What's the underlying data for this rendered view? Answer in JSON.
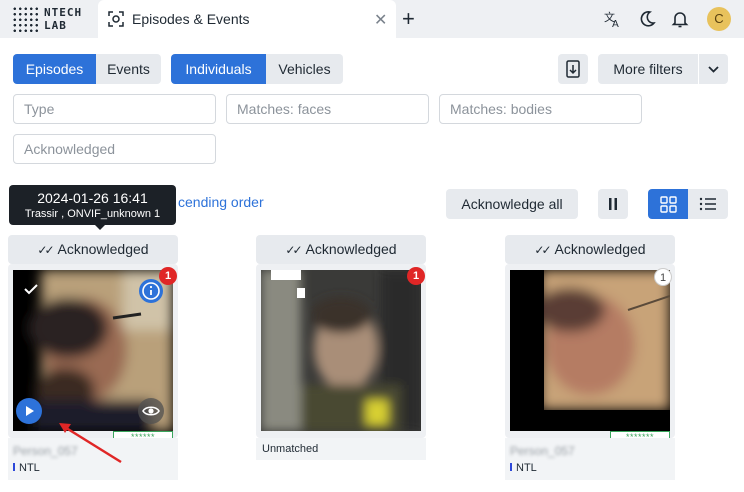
{
  "app": {
    "logo_line1": "NTECH",
    "logo_line2": "LAB",
    "tab_title": "Episodes & Events",
    "tab_close": "✕",
    "new_tab": "+",
    "avatar_letter": "C"
  },
  "toolbar": {
    "tabs_type": [
      {
        "label": "Episodes",
        "active": true
      },
      {
        "label": "Events",
        "active": false
      }
    ],
    "tabs_object": [
      {
        "label": "Individuals",
        "active": true
      },
      {
        "label": "Vehicles",
        "active": false
      }
    ],
    "more_filters": "More filters"
  },
  "filters": {
    "type_placeholder": "Type",
    "faces_placeholder": "Matches: faces",
    "bodies_placeholder": "Matches: bodies",
    "ack_placeholder": "Acknowledged"
  },
  "tooltip": {
    "datetime": "2024-01-26 16:41",
    "camera": "Trassir , ONVIF_unknown 1"
  },
  "sort_text": "cending order",
  "actions": {
    "ack_all": "Acknowledge all"
  },
  "cards": [
    {
      "status": "Acknowledged",
      "badge": "1",
      "badge_style": "red",
      "name": "Person_057",
      "source": "NTL",
      "confidence": "******",
      "matched": true
    },
    {
      "status": "Acknowledged",
      "badge": "1",
      "badge_style": "red",
      "name": "",
      "source": "Unmatched",
      "confidence": "",
      "matched": false
    },
    {
      "status": "Acknowledged",
      "badge": "1",
      "badge_style": "white",
      "name": "Person_057",
      "source": "NTL",
      "confidence": "*******",
      "matched": true
    }
  ],
  "colors": {
    "accent": "#2d72d9",
    "badge_red": "#e02626",
    "confidence_green": "#3aa55c"
  }
}
